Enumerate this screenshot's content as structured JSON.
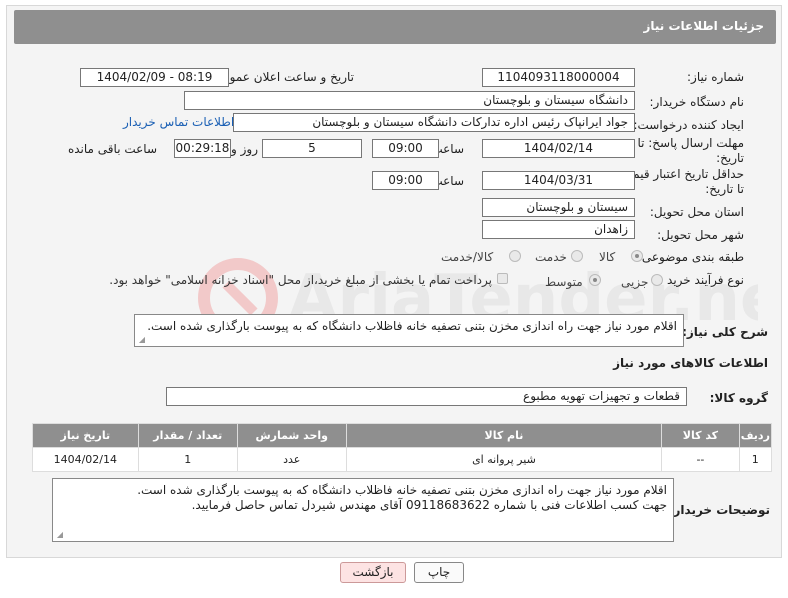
{
  "header": {
    "title": "جزئیات اطلاعات نیاز"
  },
  "fields": {
    "need_number": {
      "label": "شماره نیاز:",
      "value": "1104093118000004"
    },
    "announce_datetime": {
      "label": "تاریخ و ساعت اعلان عمومی:",
      "value": "1404/02/09 - 08:19"
    },
    "buyer_org": {
      "label": "نام دستگاه خریدار:",
      "value": "دانشگاه سیستان و بلوچستان"
    },
    "requester": {
      "label": "ایجاد کننده درخواست:",
      "value": "جواد ایرانپاک رئیس اداره تداركات دانشگاه سیستان و بلوچستان",
      "link": "اطلاعات تماس خریدار"
    },
    "response_deadline": {
      "label": "مهلت ارسال پاسخ: تا تاریخ:",
      "date": "1404/02/14",
      "time_label": "ساعت",
      "time": "09:00",
      "days": "5",
      "days_label": "روز و",
      "remaining": "00:29:18",
      "remaining_label": "ساعت باقی مانده"
    },
    "price_deadline": {
      "label": "حداقل تاریخ اعتبار قیمت: تا تاریخ:",
      "date": "1404/03/31",
      "time_label": "ساعت",
      "time": "09:00"
    },
    "delivery_province": {
      "label": "استان محل تحویل:",
      "value": "سیستان و بلوچستان"
    },
    "delivery_city": {
      "label": "شهر محل تحویل:",
      "value": "زاهدان"
    },
    "category": {
      "label": "طبقه بندی موضوعی:",
      "options": [
        "کالا",
        "خدمت",
        "کالا/خدمت"
      ],
      "selected": "کالا"
    },
    "purchase_type": {
      "label": "نوع فرآیند خرید :",
      "options": [
        "جزیی",
        "متوسط"
      ],
      "selected": "متوسط",
      "note": "پرداخت تمام یا بخشی از مبلغ خرید،از محل \"اسناد خزانه اسلامی\" خواهد بود."
    }
  },
  "description": {
    "label": "شرح کلی نیاز:",
    "value": "اقلام مورد نیاز جهت راه اندازی مخزن بتنی تصفیه خانه فاظلاب دانشگاه که به پیوست بارگذاری شده است."
  },
  "goods_info": {
    "title": "اطلاعات کالاهای مورد نیاز",
    "group_label": "گروه کالا:",
    "group_value": "قطعات و تجهیزات تهویه مطبوع"
  },
  "items_table": {
    "columns": [
      "ردیف",
      "کد کالا",
      "نام کالا",
      "واحد شمارش",
      "تعداد / مقدار",
      "تاریخ نیاز"
    ],
    "rows": [
      [
        "1",
        "--",
        "شیر پروانه ای",
        "عدد",
        "1",
        "1404/02/14"
      ]
    ]
  },
  "buyer_notes": {
    "label": "توضیحات خریدار:",
    "lines": [
      "اقلام مورد نیاز جهت راه اندازی مخزن بتنی تصفیه خانه فاظلاب دانشگاه که به پیوست بارگذاری شده است.",
      "جهت کسب اطلاعات فنی با شماره  09118683622 آقای مهندس شیردل تماس حاصل فرمایید."
    ]
  },
  "buttons": {
    "print": "چاپ",
    "back": "بازگشت"
  },
  "watermark": {
    "text": "AriaTender.net"
  }
}
